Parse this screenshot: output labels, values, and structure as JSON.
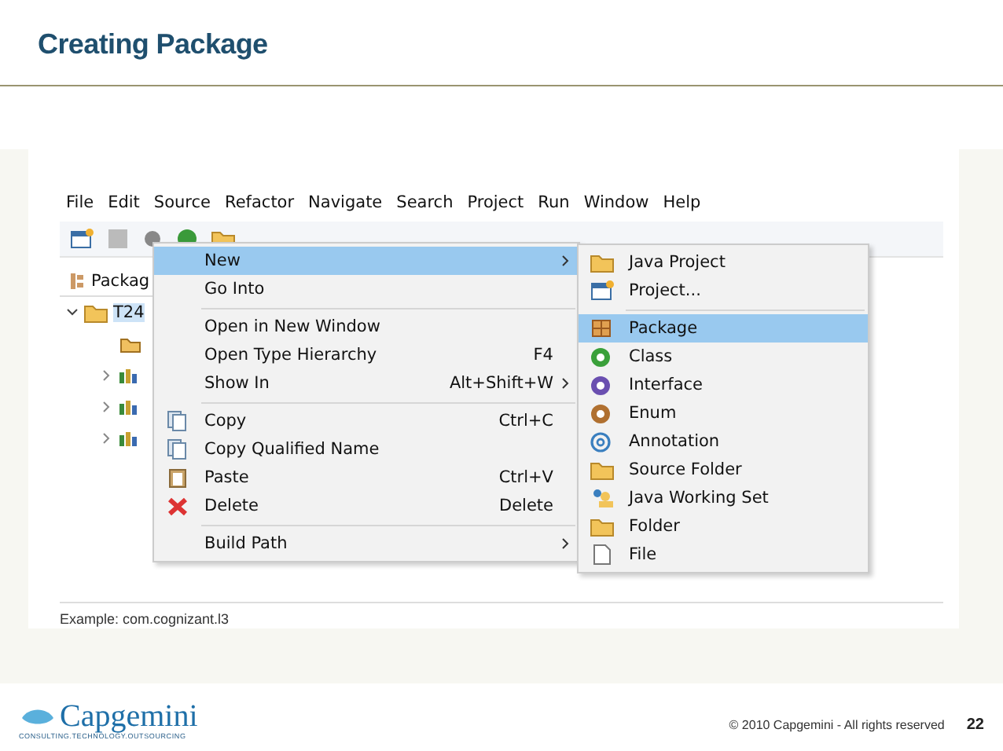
{
  "slide": {
    "title": "Creating Package",
    "caption": "Example: com.cognizant.l3",
    "copyright": "© 2010 Capgemini - All rights reserved",
    "page_number": "22",
    "logo": {
      "name": "Capgemini",
      "tagline": "CONSULTING.TECHNOLOGY.OUTSOURCING"
    }
  },
  "menubar": [
    "File",
    "Edit",
    "Source",
    "Refactor",
    "Navigate",
    "Search",
    "Project",
    "Run",
    "Window",
    "Help"
  ],
  "explorer": {
    "tab": "Packag",
    "tree": [
      {
        "label": "T24",
        "expanded": true,
        "selected": true,
        "children": [
          {
            "kind": "folder"
          },
          {
            "kind": "library",
            "expanded": false
          },
          {
            "kind": "library",
            "expanded": false
          },
          {
            "kind": "library",
            "expanded": false
          }
        ]
      }
    ]
  },
  "context_menu": [
    {
      "kind": "item",
      "label": "New",
      "selected": true,
      "submenu": true
    },
    {
      "kind": "item",
      "label": "Go Into",
      "selected": false
    },
    {
      "kind": "separator"
    },
    {
      "kind": "item",
      "label": "Open in New Window",
      "selected": false
    },
    {
      "kind": "item",
      "label": "Open Type Hierarchy",
      "shortcut": "F4",
      "selected": false
    },
    {
      "kind": "item",
      "label": "Show In",
      "shortcut": "Alt+Shift+W",
      "selected": false,
      "submenu": true
    },
    {
      "kind": "separator"
    },
    {
      "kind": "item",
      "label": "Copy",
      "shortcut": "Ctrl+C",
      "selected": false
    },
    {
      "kind": "item",
      "label": "Copy Qualified Name",
      "selected": false
    },
    {
      "kind": "item",
      "label": "Paste",
      "shortcut": "Ctrl+V",
      "selected": false
    },
    {
      "kind": "item",
      "label": "Delete",
      "shortcut": "Delete",
      "selected": false
    },
    {
      "kind": "separator"
    },
    {
      "kind": "item",
      "label": "Build Path",
      "selected": false,
      "submenu": true
    }
  ],
  "new_submenu": [
    {
      "kind": "item",
      "label": "Java Project",
      "selected": false
    },
    {
      "kind": "item",
      "label": "Project...",
      "selected": false
    },
    {
      "kind": "separator"
    },
    {
      "kind": "item",
      "label": "Package",
      "selected": true
    },
    {
      "kind": "item",
      "label": "Class",
      "selected": false
    },
    {
      "kind": "item",
      "label": "Interface",
      "selected": false
    },
    {
      "kind": "item",
      "label": "Enum",
      "selected": false
    },
    {
      "kind": "item",
      "label": "Annotation",
      "selected": false
    },
    {
      "kind": "item",
      "label": "Source Folder",
      "selected": false
    },
    {
      "kind": "item",
      "label": "Java Working Set",
      "selected": false
    },
    {
      "kind": "item",
      "label": "Folder",
      "selected": false
    },
    {
      "kind": "item",
      "label": "File",
      "selected": false
    }
  ]
}
